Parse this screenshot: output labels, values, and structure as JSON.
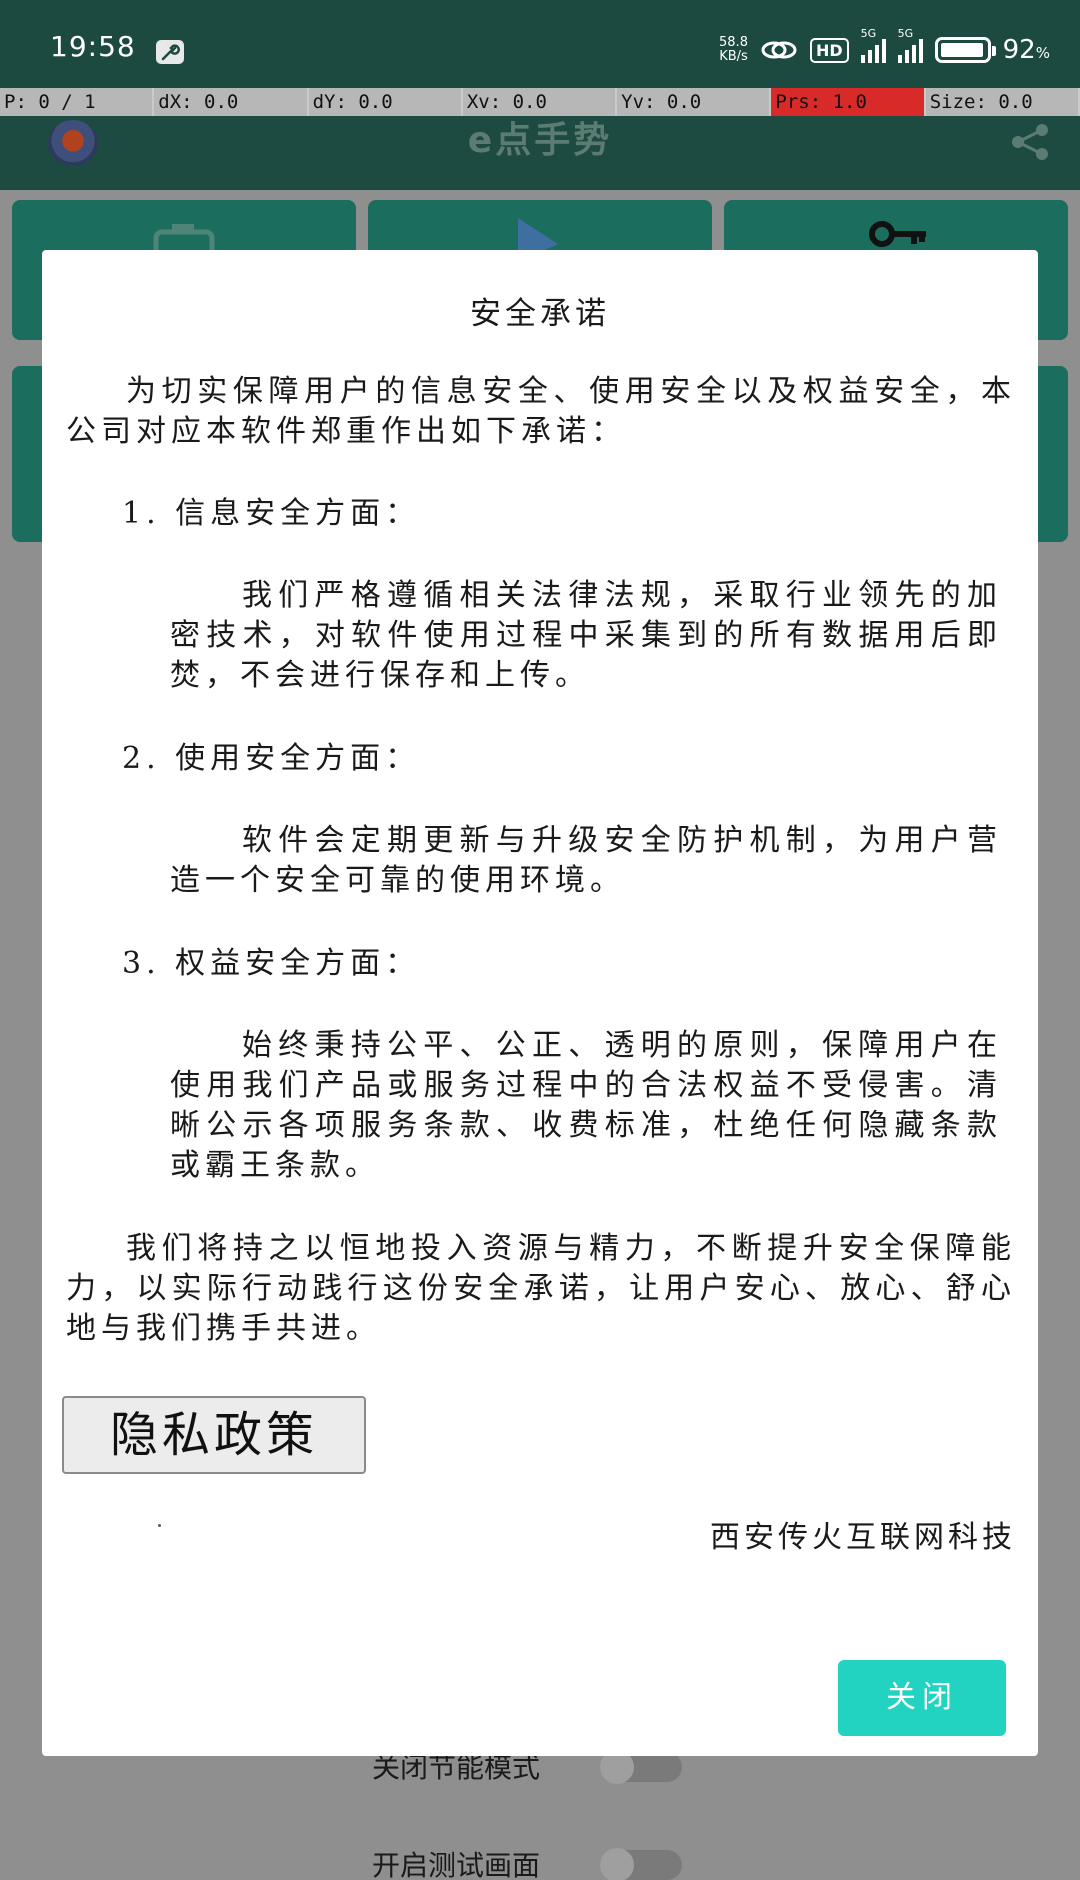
{
  "status_bar": {
    "time": "19:58",
    "net_speed_value": "58.8",
    "net_speed_unit": "KB/s",
    "hd_badge": "HD",
    "sim1_type": "5G",
    "sim2_type": "5G",
    "battery_value": "92",
    "battery_unit": "%"
  },
  "pointer_overlay": {
    "cells": [
      "P: 0 / 1",
      "dX: 0.0",
      "dY: 0.0",
      "Xv: 0.0",
      "Yv: 0.0",
      "Prs: 1.0",
      "Size: 0.0"
    ]
  },
  "app_header": {
    "title": "e点手势"
  },
  "background_rows": {
    "power_saving_label": "关闭节能模式",
    "test_screen_label": "开启测试画面"
  },
  "dialog": {
    "title": "安全承诺",
    "intro": "为切实保障用户的信息安全、使用安全以及权益安全，本公司对应本软件郑重作出如下承诺：",
    "sections": [
      {
        "heading": "1. 信息安全方面：",
        "body": "我们严格遵循相关法律法规，采取行业领先的加密技术，对软件使用过程中采集到的所有数据用后即焚，不会进行保存和上传。"
      },
      {
        "heading": "2. 使用安全方面：",
        "body": "软件会定期更新与升级安全防护机制，为用户营造一个安全可靠的使用环境。"
      },
      {
        "heading": "3. 权益安全方面：",
        "body": "始终秉持公平、公正、透明的原则，保障用户在使用我们产品或服务过程中的合法权益不受侵害。清晰公示各项服务条款、收费标准，杜绝任何隐藏条款或霸王条款。"
      }
    ],
    "closing": "我们将持之以恒地投入资源与精力，不断提升安全保障能力，以实际行动践行这份安全承诺，让用户安心、放心、舒心地与我们携手共进。",
    "privacy_button": "隐私政策",
    "company": "西安传火互联网科技",
    "close_button": "关闭"
  },
  "colors": {
    "status_bar_bg": "#1c4a40",
    "pressure_cell": "#d92a2a",
    "close_button": "#21d3c0",
    "dialog_bg": "#ffffff"
  },
  "icons": [
    "wrench-icon",
    "hd-voice-icon",
    "signal-icon",
    "battery-icon",
    "app-logo-icon",
    "share-icon",
    "camera-icon",
    "play-icon",
    "key-icon"
  ]
}
